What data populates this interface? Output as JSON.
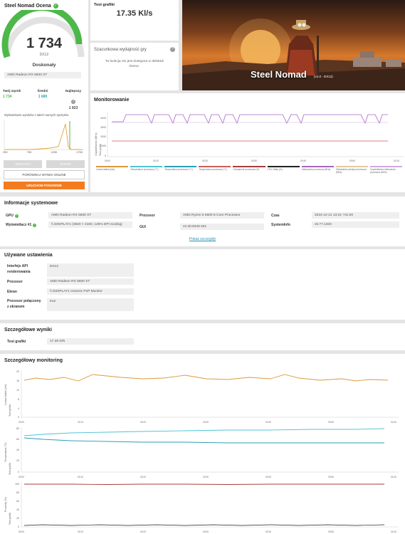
{
  "score_panel": {
    "title": "Steel Nomad Ocena",
    "score": "1 734",
    "api": "DX12",
    "rating": "Doskonały",
    "gpu": "AMD Radeon RX 5600 XT",
    "your_label": "Twój wynik",
    "your_value": "1 734",
    "avg_label": "Średni",
    "avg_value": "1 689",
    "best_label": "Najlepszy",
    "best_value": "1 923",
    "hist_caption": "Wyświetlanie wyników z takich samych sprzętów",
    "hist_ticks": [
      "250",
      "750",
      "1250",
      "1750"
    ],
    "btn_load": "WCZYTAJ",
    "btn_save": "ZAPISZ",
    "btn_compare": "PORÓWNAJ WYNIKI ONLINE",
    "btn_rerun": "URUCHOM PONOWNIE"
  },
  "test_panel": {
    "title": "Test grafiki",
    "value": "17.35 Kl/s"
  },
  "estimate_panel": {
    "title": "Szacunkowa wydajność gry",
    "text_line1": "Ta funkcja nie jest dostępna w 3DMark",
    "text_line2": "Demo."
  },
  "banner": {
    "title": "Steel Nomad",
    "version": "(v1.0 · DX12)"
  },
  "monitoring": {
    "title": "Monitorowanie",
    "y_label": "Częstotliwość (MHz)",
    "y_sublabel": "Test grafiki",
    "y_ticks": [
      "4000",
      "3000",
      "2000",
      "1000",
      "0"
    ],
    "x_ticks": [
      "00:00",
      "00:10",
      "00:20",
      "00:30",
      "00:40",
      "00:50",
      "01:00"
    ],
    "legend": [
      {
        "label": "Liczba klatek (kl/s)",
        "color": "#d99a3c"
      },
      {
        "label": "Temperatura procesora (°C)",
        "color": "#4dc3d6"
      },
      {
        "label": "Temperatura procesora (°C)",
        "color": "#2a9fb5"
      },
      {
        "label": "Temperatura procesora (°C)",
        "color": "#c95e5e"
      },
      {
        "label": "Obciążenie procesora (%)",
        "color": "#a33e3e"
      },
      {
        "label": "CPU Utility (%)",
        "color": "#222222"
      },
      {
        "label": "Taktowanie procesora (MHz)",
        "color": "#a565c2"
      },
      {
        "label": "Taktowanie pamięci procesora (MHz)",
        "color": "#e2c9a0"
      },
      {
        "label": "Częstotliwość taktowania procesora (MHz)",
        "color": "#cfa8de"
      }
    ]
  },
  "sysinfo": {
    "title": "Informacje systemowe",
    "gpu_label": "GPU",
    "gpu_value": "AMD Radeon RX 5600 XT",
    "display_label": "Wyświetlacz #1",
    "display_value": "\\\\.\\DISPLAY1 (3840 × 2160, 125% DPI scaling)",
    "cpu_label": "Procesor",
    "cpu_value": "AMD Ryzen 5 5600 6-Core Processor",
    "gui_label": "GUI",
    "gui_value": "v2.30.8348 s64",
    "time_label": "Czas",
    "time_value": "2024-12-21 13:22 +01:00",
    "sysinfo_label": "SystemInfo",
    "sysinfo_value": "v5.77.1320",
    "details_link": "Pokaż szczegóły"
  },
  "settings": {
    "title": "Używane ustawienia",
    "rows": [
      {
        "label1": "Interfejs API",
        "label2": "renderowania",
        "value": "DX12"
      },
      {
        "label1": "Procesor",
        "label2": "",
        "value": "AMD Radeon RX 5600 XT"
      },
      {
        "label1": "Ekran",
        "label2": "",
        "value": "\\\\.\\DISPLAY1 Generic PnP Monitor"
      },
      {
        "label1": "Procesor połączony",
        "label2": "z ekranem",
        "value": "true"
      }
    ]
  },
  "detailed_results": {
    "title": "Szczegółowe wyniki",
    "label": "Test grafiki",
    "value": "17.35 Kl/s"
  },
  "detailed_monitoring": {
    "title": "Szczegółowy monitoring",
    "chart1_ylabel": "Liczba klatek (kl/s)",
    "chart2_ylabel": "Temperatura (°C)",
    "chart3_ylabel": "Procenty (%)",
    "sub_ylabel": "Test grafiki",
    "y1_ticks": [
      "20",
      "16",
      "12",
      "8",
      "4",
      "0"
    ],
    "y2_ticks": [
      "80",
      "60",
      "40",
      "20",
      "0"
    ],
    "y3_ticks": [
      "100",
      "80",
      "60",
      "40",
      "20",
      "0"
    ],
    "x_ticks": [
      "00:00",
      "00:10",
      "00:20",
      "00:30",
      "00:40",
      "00:50",
      "01:00"
    ]
  }
}
